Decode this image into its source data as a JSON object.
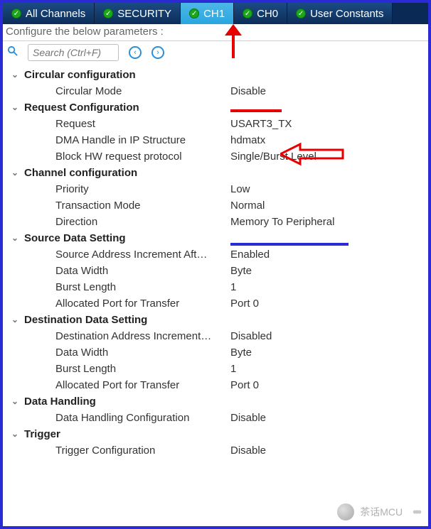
{
  "tabs": [
    {
      "label": "All Channels"
    },
    {
      "label": "SECURITY"
    },
    {
      "label": "CH1"
    },
    {
      "label": "CH0"
    },
    {
      "label": "User Constants"
    }
  ],
  "active_tab_label": "CH1",
  "instruction_text": "Configure the below parameters :",
  "search": {
    "placeholder": "Search (Ctrl+F)"
  },
  "groups": [
    {
      "title": "Circular configuration",
      "rows": [
        {
          "label": "Circular Mode",
          "value": "Disable"
        }
      ]
    },
    {
      "title": "Request Configuration",
      "rows": [
        {
          "label": "Request",
          "value": "USART3_TX"
        },
        {
          "label": "DMA Handle in IP Structure",
          "value": "hdmatx"
        },
        {
          "label": "Block HW request protocol",
          "value": "Single/Burst Level"
        }
      ]
    },
    {
      "title": "Channel configuration",
      "rows": [
        {
          "label": "Priority",
          "value": "Low"
        },
        {
          "label": "Transaction Mode",
          "value": "Normal"
        },
        {
          "label": "Direction",
          "value": "Memory To Peripheral"
        }
      ]
    },
    {
      "title": "Source Data Setting",
      "rows": [
        {
          "label": "Source Address Increment Aft…",
          "value": "Enabled"
        },
        {
          "label": "Data Width",
          "value": "Byte"
        },
        {
          "label": "Burst Length",
          "value": "1"
        },
        {
          "label": "Allocated Port for Transfer",
          "value": "Port 0"
        }
      ]
    },
    {
      "title": "Destination Data Setting",
      "rows": [
        {
          "label": "Destination Address Increment…",
          "value": "Disabled"
        },
        {
          "label": "Data Width",
          "value": "Byte"
        },
        {
          "label": "Burst Length",
          "value": "1"
        },
        {
          "label": "Allocated Port for Transfer",
          "value": "Port 0"
        }
      ]
    },
    {
      "title": "Data Handling",
      "rows": [
        {
          "label": "Data Handling Configuration",
          "value": "Disable"
        }
      ]
    },
    {
      "title": "Trigger",
      "rows": [
        {
          "label": "Trigger Configuration",
          "value": "Disable"
        }
      ]
    }
  ],
  "watermark": "茶话MCU"
}
